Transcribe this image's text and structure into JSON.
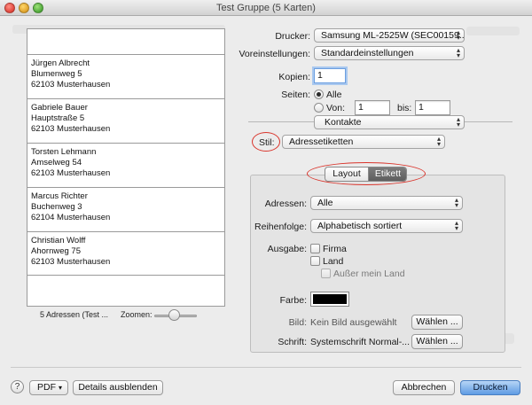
{
  "window": {
    "title": "Test Gruppe (5 Karten)"
  },
  "preview": {
    "cards": [
      {
        "lines": [
          "Jürgen Albrecht",
          "Blumenweg 5",
          "62103 Musterhausen"
        ]
      },
      {
        "lines": [
          "Gabriele Bauer",
          "Hauptstraße 5",
          "62103 Musterhausen"
        ]
      },
      {
        "lines": [
          "Torsten Lehmann",
          "Amselweg 54",
          "62103 Musterhausen"
        ]
      },
      {
        "lines": [
          "Marcus Richter",
          "Buchenweg 3",
          "62104 Musterhausen"
        ]
      },
      {
        "lines": [
          "Christian Wolff",
          "Ahornweg 75",
          "62103 Musterhausen"
        ]
      }
    ],
    "count_label": "5 Adressen (Test ...",
    "zoom_label": "Zoomen:",
    "zoom_level": 0.45
  },
  "settings": {
    "printer_label": "Drucker:",
    "printer_value": "Samsung ML-2525W (SEC00159...",
    "presets_label": "Voreinstellungen:",
    "presets_value": "Standardeinstellungen",
    "copies_label": "Kopien:",
    "copies_value": "1",
    "pages_label": "Seiten:",
    "pages_all": "Alle",
    "pages_from": "Von:",
    "pages_from_value": "1",
    "pages_to": "bis:",
    "pages_to_value": "1",
    "app_section": "Kontakte",
    "style_label": "Stil:",
    "style_value": "Adressetiketten",
    "tabs": [
      "Layout",
      "Etikett"
    ],
    "addresses_label": "Adressen:",
    "addresses_value": "Alle",
    "order_label": "Reihenfolge:",
    "order_value": "Alphabetisch sortiert",
    "output_label": "Ausgabe:",
    "output_options": [
      "Firma",
      "Land",
      "Außer mein Land"
    ],
    "color_label": "Farbe:",
    "color_value": "#000000",
    "image_label": "Bild:",
    "image_value": "Kein Bild ausgewählt",
    "image_button": "Wählen ...",
    "font_label": "Schrift:",
    "font_value": "Systemschrift Normal-...",
    "font_button": "Wählen ..."
  },
  "footer": {
    "help": "?",
    "pdf": "PDF",
    "details": "Details ausblenden",
    "cancel": "Abbrechen",
    "print": "Drucken"
  },
  "annotation_color": "#d9342b",
  "accent_color": "#5e9be3"
}
